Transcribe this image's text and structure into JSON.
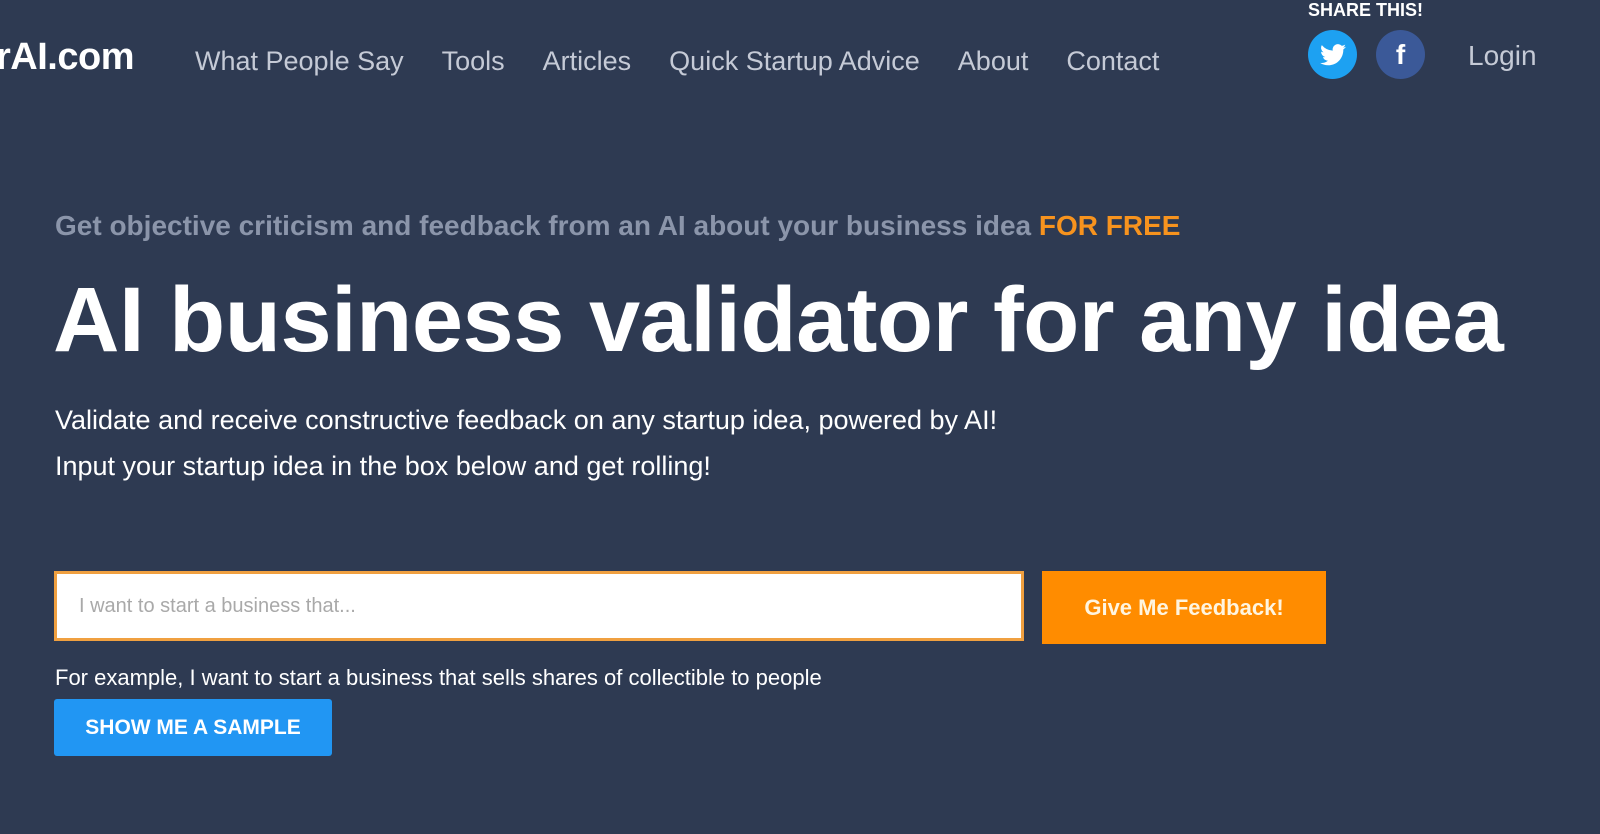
{
  "header": {
    "logo": "rAI.com",
    "nav": [
      {
        "label": "What People Say"
      },
      {
        "label": "Tools"
      },
      {
        "label": "Articles"
      },
      {
        "label": "Quick Startup Advice"
      },
      {
        "label": "About"
      },
      {
        "label": "Contact"
      }
    ],
    "share_label": "SHARE THIS!",
    "social": [
      {
        "name": "twitter",
        "icon": "twitter-icon",
        "color": "#1da1f2"
      },
      {
        "name": "facebook",
        "icon": "facebook-icon",
        "glyph": "f",
        "color": "#3b5998"
      }
    ],
    "login_label": "Login"
  },
  "hero": {
    "tagline": "Get objective criticism and feedback from an AI about your business idea ",
    "tagline_accent": "FOR FREE",
    "headline": "AI business validator for any idea",
    "subtitle_1": "Validate and receive constructive feedback on any startup idea, powered by AI!",
    "subtitle_2": "Input your startup idea in the box below and get rolling!"
  },
  "form": {
    "input_placeholder": "I want to start a business that...",
    "input_value": "",
    "submit_label": "Give Me Feedback!",
    "example_text": "For example, I want to start a business that sells shares of collectible to people",
    "sample_label": "SHOW ME A SAMPLE"
  },
  "colors": {
    "background": "#2e3a52",
    "accent_orange": "#ff8c00",
    "sample_blue": "#2196f3",
    "tagline_gray": "#8b95aa"
  }
}
